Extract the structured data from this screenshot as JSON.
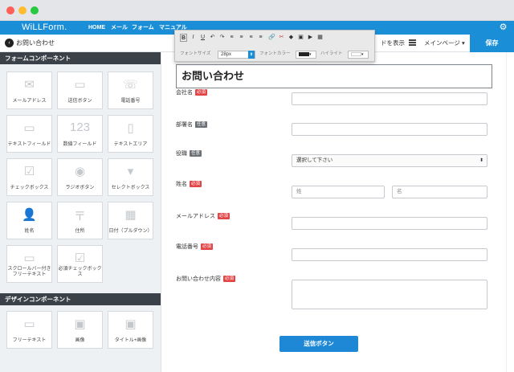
{
  "app": {
    "logo": "WiLLForm.",
    "nav": [
      "HOME",
      "メール",
      "フォーム",
      "マニュアル"
    ]
  },
  "subbar": {
    "back_label": "お問い合わせ",
    "sidebar_toggle": "ドを表示",
    "main_page": "メインページ",
    "save_label": "保存"
  },
  "sidebar": {
    "form_section": "フォームコンポーネント",
    "form_items": [
      "メールアドレス",
      "送信ボタン",
      "電話番号",
      "テキストフィールド",
      "数値フィールド",
      "テキストエリア",
      "チェックボックス",
      "ラジオボタン",
      "セレクトボックス",
      "姓名",
      "住所",
      "日付（プルダウン）",
      "スクロールバー付き\nフリーテキスト",
      "必須チェックボックス"
    ],
    "design_section": "デザインコンポーネント",
    "design_items": [
      "フリーテキスト",
      "画像",
      "タイトル+画像"
    ]
  },
  "toolbar": {
    "font_size_label": "フォントサイズ",
    "font_size_value": "28px",
    "font_color_label": "フォントカラー",
    "highlight_label": "ハイライト"
  },
  "form": {
    "title": "お問い合わせ",
    "badges": {
      "required": "必須",
      "optional": "任意"
    },
    "fields": [
      {
        "label": "会社名",
        "badge": "required"
      },
      {
        "label": "部署名",
        "badge": "optional"
      },
      {
        "label": "役職",
        "badge": "optional",
        "select": "選択して下さい"
      },
      {
        "label": "姓名",
        "badge": "required",
        "last_ph": "姓",
        "first_ph": "名"
      },
      {
        "label": "メールアドレス",
        "badge": "required"
      },
      {
        "label": "電話番号",
        "badge": "required"
      },
      {
        "label": "お問い合わせ内容",
        "badge": "required"
      }
    ],
    "submit": "送信ボタン"
  }
}
